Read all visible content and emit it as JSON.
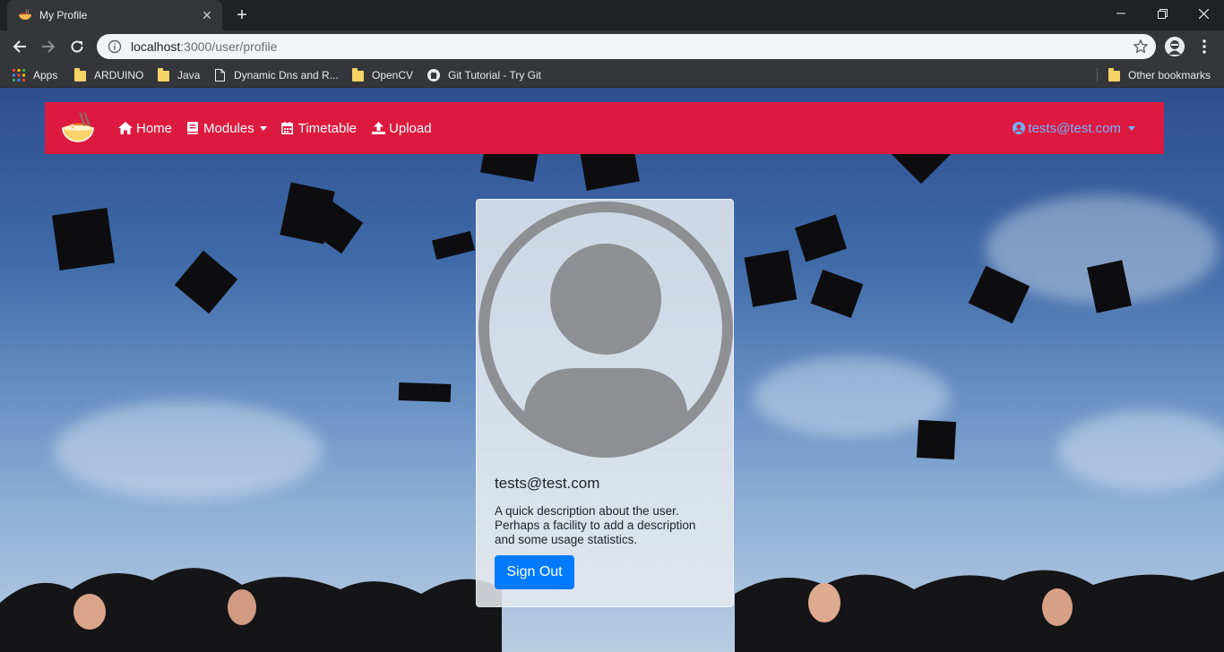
{
  "browser": {
    "tab_title": "My Profile",
    "url_host": "localhost",
    "url_rest": ":3000/user/profile",
    "bookmarks": [
      {
        "label": "Apps",
        "icon": "apps-grid-icon"
      },
      {
        "label": "ARDUINO",
        "icon": "folder-icon"
      },
      {
        "label": "Java",
        "icon": "folder-icon"
      },
      {
        "label": "Dynamic Dns and R...",
        "icon": "page-icon"
      },
      {
        "label": "OpenCV",
        "icon": "folder-icon"
      },
      {
        "label": "Git Tutorial - Try Git",
        "icon": "github-icon"
      }
    ],
    "other_bookmarks": "Other bookmarks"
  },
  "navbar": {
    "color": "#dc1a3f",
    "items": [
      {
        "label": "Home",
        "icon": "home-icon"
      },
      {
        "label": "Modules",
        "icon": "book-icon",
        "dropdown": true
      },
      {
        "label": "Timetable",
        "icon": "calendar-icon"
      },
      {
        "label": "Upload",
        "icon": "upload-icon"
      }
    ],
    "user_email": "tests@test.com"
  },
  "profile": {
    "title": "tests@test.com",
    "description": "A quick description about the user. Perhaps a facility to add a description and some usage statistics.",
    "sign_out_label": "Sign Out",
    "button_color": "#007bff"
  }
}
